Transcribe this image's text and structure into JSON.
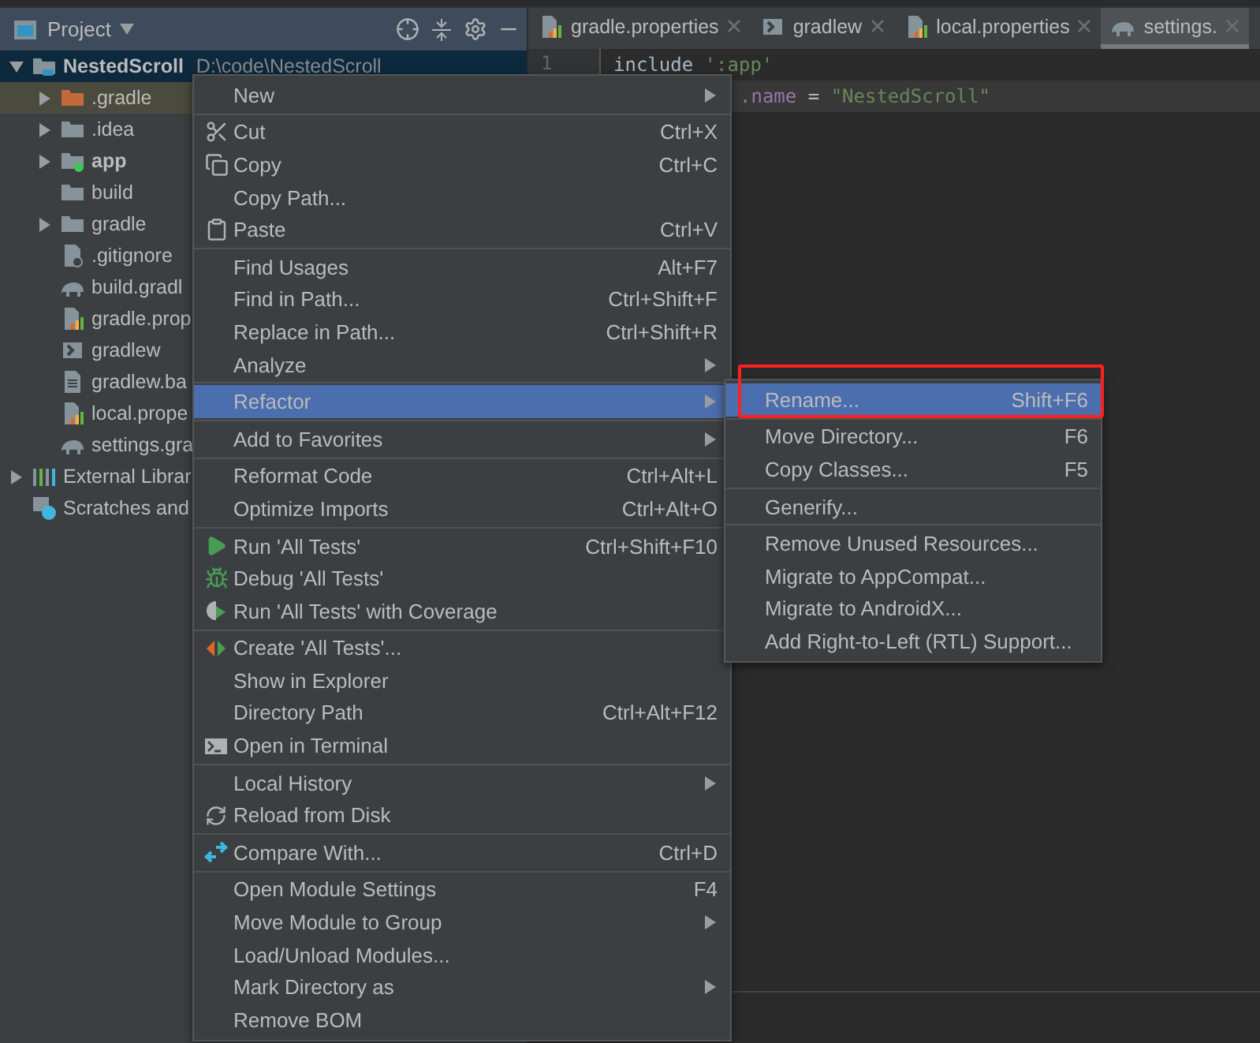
{
  "toolbar": {
    "title": "Project"
  },
  "tabs": [
    {
      "label": "gradle.properties",
      "kind": "properties",
      "selected": false
    },
    {
      "label": "gradlew",
      "kind": "script",
      "selected": false
    },
    {
      "label": "local.properties",
      "kind": "properties",
      "selected": false
    },
    {
      "label": "settings.",
      "kind": "gradle",
      "selected": true
    }
  ],
  "tree": [
    {
      "label": "NestedScroll",
      "path": "D:\\code\\NestedScroll",
      "kind": "module",
      "expanded": true,
      "selected": true,
      "children": [
        {
          "label": ".gradle",
          "kind": "excluded",
          "expanded": false,
          "selected": false
        },
        {
          "label": ".idea",
          "kind": "folder",
          "expanded": false,
          "selected": false
        },
        {
          "label": "app",
          "kind": "app",
          "expanded": false,
          "selected": false
        },
        {
          "label": "build",
          "kind": "folder",
          "selected": false
        },
        {
          "label": "gradle",
          "kind": "folder",
          "expanded": false,
          "selected": false
        },
        {
          "label": ".gitignore",
          "kind": "ignore",
          "selected": false
        },
        {
          "label": "build.gradl",
          "kind": "gradle",
          "selected": false
        },
        {
          "label": "gradle.prop",
          "kind": "properties",
          "selected": false
        },
        {
          "label": "gradlew",
          "kind": "script",
          "selected": false
        },
        {
          "label": "gradlew.ba",
          "kind": "text",
          "selected": false
        },
        {
          "label": "local.prope",
          "kind": "properties",
          "selected": false
        },
        {
          "label": "settings.gra",
          "kind": "gradle",
          "selected": false
        }
      ]
    },
    {
      "label": "External Librar",
      "kind": "libraries",
      "expanded": false,
      "selected": false
    },
    {
      "label": "Scratches and",
      "kind": "scratches",
      "selected": false
    }
  ],
  "editor": {
    "lines": [
      {
        "number": "1",
        "kind": "code",
        "current": false,
        "tokens": [
          {
            "text": "include",
            "kind": "plain"
          },
          {
            "text": " ':app'",
            "kind": "string"
          }
        ]
      },
      {
        "kind": "partial",
        "current": true,
        "tokens": [
          {
            "text": ".name",
            "kind": "field"
          },
          {
            "text": " = ",
            "kind": "plain"
          },
          {
            "text": "\"NestedScroll\"",
            "kind": "string"
          }
        ]
      }
    ]
  },
  "menu": {
    "items": [
      {
        "kind": "item",
        "label": "New",
        "submenu": true,
        "selected": false
      },
      {
        "kind": "separator"
      },
      {
        "kind": "cut",
        "label": "Cut",
        "shortcut": "Ctrl+X",
        "submenu": false,
        "selected": false
      },
      {
        "kind": "copy",
        "label": "Copy",
        "shortcut": "Ctrl+C",
        "submenu": false,
        "selected": false
      },
      {
        "kind": "item",
        "label": "Copy Path...",
        "submenu": false,
        "selected": false
      },
      {
        "kind": "paste",
        "label": "Paste",
        "shortcut": "Ctrl+V",
        "submenu": false,
        "selected": false
      },
      {
        "kind": "separator"
      },
      {
        "kind": "item",
        "label": "Find Usages",
        "shortcut": "Alt+F7",
        "submenu": false,
        "selected": false
      },
      {
        "kind": "item",
        "label": "Find in Path...",
        "shortcut": "Ctrl+Shift+F",
        "submenu": false,
        "selected": false
      },
      {
        "kind": "item",
        "label": "Replace in Path...",
        "shortcut": "Ctrl+Shift+R",
        "submenu": false,
        "selected": false
      },
      {
        "kind": "item",
        "label": "Analyze",
        "submenu": true,
        "selected": false
      },
      {
        "kind": "separator"
      },
      {
        "kind": "item",
        "label": "Refactor",
        "submenu": true,
        "selected": true
      },
      {
        "kind": "separator"
      },
      {
        "kind": "item",
        "label": "Add to Favorites",
        "submenu": true,
        "selected": false
      },
      {
        "kind": "separator"
      },
      {
        "kind": "item",
        "label": "Reformat Code",
        "shortcut": "Ctrl+Alt+L",
        "submenu": false,
        "selected": false
      },
      {
        "kind": "item",
        "label": "Optimize Imports",
        "shortcut": "Ctrl+Alt+O",
        "submenu": false,
        "selected": false
      },
      {
        "kind": "separator"
      },
      {
        "kind": "run",
        "label": "Run 'All Tests'",
        "shortcut": "Ctrl+Shift+F10",
        "submenu": false,
        "selected": false
      },
      {
        "kind": "debug",
        "label": "Debug 'All Tests'",
        "submenu": false,
        "selected": false
      },
      {
        "kind": "coverage",
        "label": "Run 'All Tests' with Coverage",
        "submenu": false,
        "selected": false
      },
      {
        "kind": "separator"
      },
      {
        "kind": "create",
        "label": "Create 'All Tests'...",
        "submenu": false,
        "selected": false
      },
      {
        "kind": "item",
        "label": "Show in Explorer",
        "submenu": false,
        "selected": false
      },
      {
        "kind": "item",
        "label": "Directory Path",
        "shortcut": "Ctrl+Alt+F12",
        "submenu": false,
        "selected": false
      },
      {
        "kind": "terminal",
        "label": "Open in Terminal",
        "submenu": false,
        "selected": false
      },
      {
        "kind": "separator"
      },
      {
        "kind": "item",
        "label": "Local History",
        "submenu": true,
        "selected": false
      },
      {
        "kind": "reload",
        "label": "Reload from Disk",
        "submenu": false,
        "selected": false
      },
      {
        "kind": "separator"
      },
      {
        "kind": "compare",
        "label": "Compare With...",
        "shortcut": "Ctrl+D",
        "submenu": false,
        "selected": false
      },
      {
        "kind": "separator"
      },
      {
        "kind": "item",
        "label": "Open Module Settings",
        "shortcut": "F4",
        "submenu": false,
        "selected": false
      },
      {
        "kind": "item",
        "label": "Move Module to Group",
        "submenu": true,
        "selected": false
      },
      {
        "kind": "item",
        "label": "Load/Unload Modules...",
        "submenu": false,
        "selected": false
      },
      {
        "kind": "item",
        "label": "Mark Directory as",
        "submenu": true,
        "selected": false
      },
      {
        "kind": "item",
        "label": "Remove BOM",
        "submenu": false,
        "selected": false
      }
    ]
  },
  "submenu": {
    "items": [
      {
        "kind": "item",
        "label": "Rename...",
        "shortcut": "Shift+F6",
        "selected": true,
        "annotated": true
      },
      {
        "kind": "separator"
      },
      {
        "kind": "item",
        "label": "Move Directory...",
        "shortcut": "F6",
        "selected": false,
        "annotated": false
      },
      {
        "kind": "item",
        "label": "Copy Classes...",
        "shortcut": "F5",
        "selected": false,
        "annotated": false
      },
      {
        "kind": "separator"
      },
      {
        "kind": "item",
        "label": "Generify...",
        "selected": false,
        "annotated": false
      },
      {
        "kind": "separator"
      },
      {
        "kind": "item",
        "label": "Remove Unused Resources...",
        "selected": false,
        "annotated": false
      },
      {
        "kind": "item",
        "label": "Migrate to AppCompat...",
        "selected": false,
        "annotated": false
      },
      {
        "kind": "item",
        "label": "Migrate to AndroidX...",
        "selected": false,
        "annotated": false
      },
      {
        "kind": "item",
        "label": "Add Right-to-Left (RTL) Support...",
        "selected": false,
        "annotated": false
      }
    ]
  }
}
